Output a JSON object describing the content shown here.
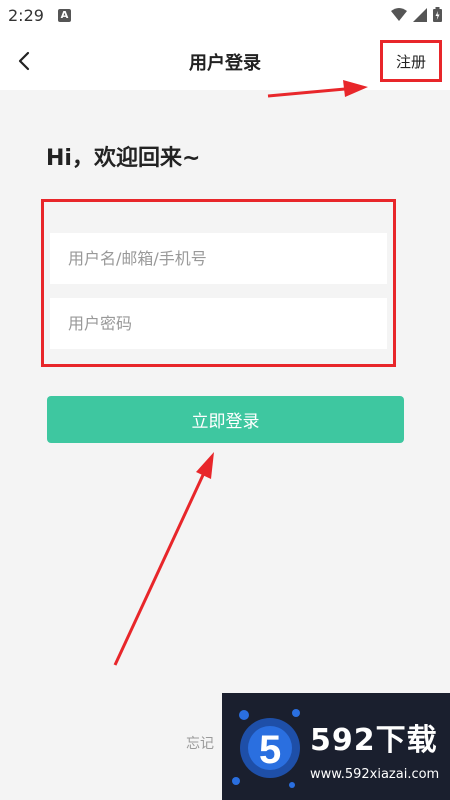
{
  "status_bar": {
    "time": "2:29",
    "notification_letter": "A",
    "icons": [
      "wifi-icon",
      "signal-icon",
      "battery-icon"
    ]
  },
  "header": {
    "back_icon": "chevron-left-icon",
    "title": "用户登录",
    "register_label": "注册"
  },
  "greeting": "Hi，欢迎回来~",
  "form": {
    "username_placeholder": "用户名/邮箱/手机号",
    "password_placeholder": "用户密码"
  },
  "login_button_label": "立即登录",
  "forgot_label": "忘记",
  "watermark": {
    "brand": "592下载",
    "url": "www.592xiazai.com"
  },
  "colors": {
    "accent": "#3ec7a0",
    "annotation_red": "#e8262a",
    "background": "#f4f4f4"
  }
}
